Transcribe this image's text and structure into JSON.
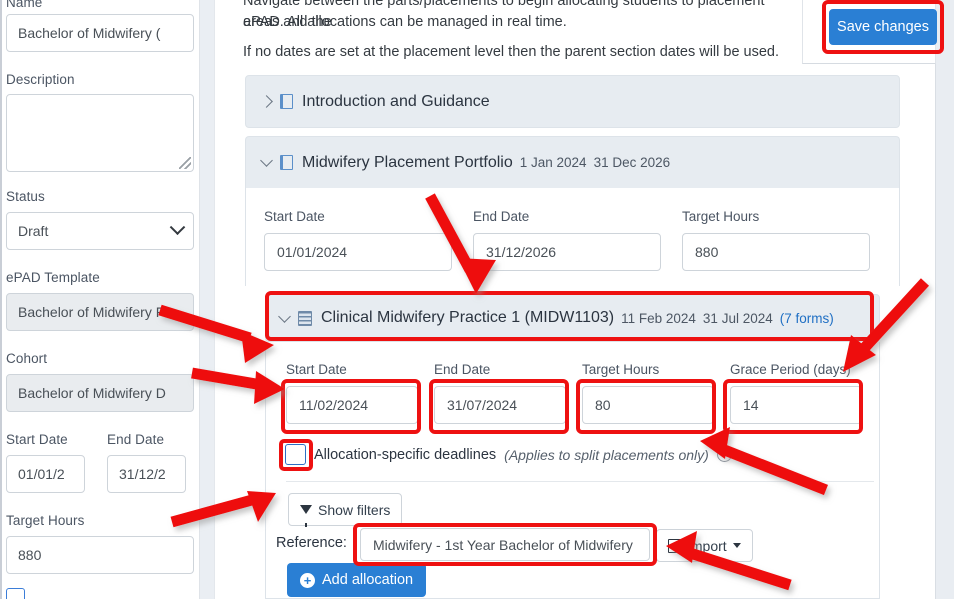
{
  "left_panel": {
    "name_label": "Name",
    "name_value": "Bachelor of Midwifery (",
    "description_label": "Description",
    "description_value": "",
    "status_label": "Status",
    "status_value": "Draft",
    "epad_template_label": "ePAD Template",
    "epad_template_value": "Bachelor of Midwifery F",
    "cohort_label": "Cohort",
    "cohort_value": "Bachelor of Midwifery D",
    "start_date_label": "Start Date",
    "start_date_value": "01/01/2",
    "end_date_label": "End Date",
    "end_date_value": "31/12/2",
    "target_hours_label": "Target Hours",
    "target_hours_value": "880"
  },
  "intro": {
    "line1": "Navigate between the parts/placements to begin allocating students to placement areas and the",
    "line2": "ePAD. All allocations can be managed in real time.",
    "line3": "If no dates are set at the placement level then the parent section dates will be used."
  },
  "toolbar": {
    "save_label": "Save changes",
    "save_color": "#2a7fd4"
  },
  "sections": [
    {
      "title": "Introduction and Guidance",
      "expanded": false,
      "icon": "book-icon",
      "meta": ""
    },
    {
      "title": "Midwifery Placement Portfolio",
      "expanded": true,
      "icon": "book-icon",
      "start_meta": "1 Jan 2024",
      "end_meta": "31 Dec 2026",
      "fields": {
        "start_date_label": "Start Date",
        "start_date_value": "01/01/2024",
        "end_date_label": "End Date",
        "end_date_value": "31/12/2026",
        "target_hours_label": "Target Hours",
        "target_hours_value": "880"
      }
    }
  ],
  "placement": {
    "title": "Clinical Midwifery Practice 1 (MIDW1103)",
    "icon": "building-icon",
    "start_meta": "11 Feb 2024",
    "end_meta": "31 Jul 2024",
    "forms_link": "(7 forms)",
    "fields": {
      "start_date_label": "Start Date",
      "start_date_value": "11/02/2024",
      "end_date_label": "End Date",
      "end_date_value": "31/07/2024",
      "target_hours_label": "Target Hours",
      "target_hours_value": "80",
      "grace_period_label": "Grace Period (days)",
      "grace_period_value": "14"
    },
    "checkbox": {
      "label": "Allocation-specific deadlines",
      "note": "(Applies to split placements only)",
      "info_icon": "info-icon",
      "checked": false
    },
    "filters_button": "Show filters",
    "reference_label": "Reference:",
    "reference_value": "Midwifery - 1st Year Bachelor of Midwifery",
    "import_button": "Import",
    "add_allocation_button": "Add allocation"
  },
  "annotation": {
    "color": "#ee1111",
    "highlight_count": 8
  }
}
